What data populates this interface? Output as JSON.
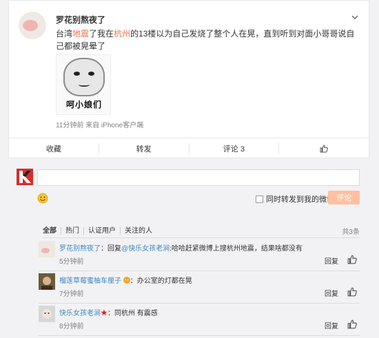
{
  "post": {
    "author": "罗花别熬夜了",
    "text_parts": [
      "台湾",
      "地震",
      "了我在",
      "杭州",
      "的13楼以为自己发烧了整个人在晃，直到听到对面小哥哥说自己都被晃晕了"
    ],
    "image_caption": "呵小娘们",
    "meta": "11分钟前 来自 iPhone客户端",
    "actions": {
      "favorite": "收藏",
      "repost": "转发",
      "comment": "评论 3"
    }
  },
  "composer": {
    "input_value": "",
    "repost_label": "同时转发到我的微博",
    "submit_label": "评论"
  },
  "filters": {
    "tabs": [
      "全部",
      "热门",
      "认证用户",
      "关注的人"
    ],
    "total": "共3条"
  },
  "comments": [
    {
      "user": "罗花别熬夜了",
      "pre": "：回复",
      "mention": "@快乐女孩老涧",
      "body": ":哈哈赶紧微博上搜杭州地震，结果啥都没有",
      "time": "5分钟前",
      "reply": "回复"
    },
    {
      "user": "榴莲草莓蜜柚车厘子",
      "pre": "",
      "mention": "",
      "body": "：办公室的灯都在晃",
      "time": "7分钟前",
      "reply": "回复"
    },
    {
      "user": "快乐女孩老涧",
      "pre": "",
      "mention": "",
      "body": "：同杭州 有震感",
      "time": "8分钟前",
      "reply": "回复"
    }
  ],
  "colors": {
    "accent": "#eb7350",
    "link": "#3c8bc2",
    "submit_bg": "#ffc09f",
    "brand_logo": "#d92b2b"
  }
}
